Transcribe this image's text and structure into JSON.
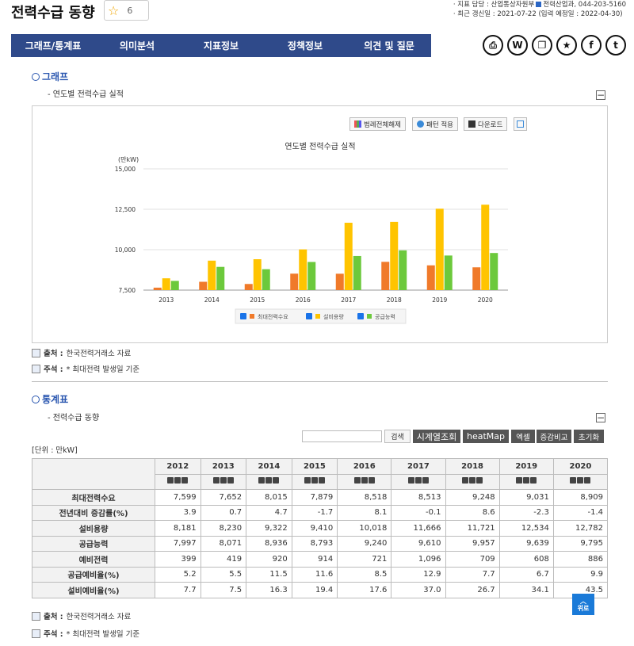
{
  "page": {
    "title": "전력수급 동향",
    "favorite_count": "6",
    "meta_line1_prefix": "· 지표 담당 : 산업통상자원부",
    "meta_line1_suffix": "전력산업과, 044-203-5160",
    "meta_line2": "· 최근 갱신일 : 2021-07-22 (입력 예정일 : 2022-04-30)"
  },
  "nav": [
    "그래프/통계표",
    "의미분석",
    "지표정보",
    "정책정보",
    "의견 및 질문"
  ],
  "share_icons": [
    {
      "name": "print-icon",
      "glyph": "⎙"
    },
    {
      "name": "word-icon",
      "glyph": "W"
    },
    {
      "name": "copy-icon",
      "glyph": "❐"
    },
    {
      "name": "bookmark-star-icon",
      "glyph": "★"
    },
    {
      "name": "facebook-icon",
      "glyph": "f"
    },
    {
      "name": "twitter-icon",
      "glyph": "t"
    }
  ],
  "graph": {
    "section_title": "그래프",
    "subtitle": "- 연도별 전력수급 실적",
    "buttons": {
      "legend_off": "범례전체해제",
      "pattern": "패턴 적용",
      "download": "다운로드"
    },
    "source_label": "출처 :",
    "source_value": "한국전력거래소 자료",
    "note_label": "주석 :",
    "note_value": "* 최대전력 발생일 기준"
  },
  "chart_data": {
    "type": "bar",
    "title": "연도별 전력수급 실적",
    "ylabel": "(만kW)",
    "ylim": [
      7500,
      15000
    ],
    "yticks": [
      "7,500",
      "10,000",
      "12,500",
      "15,000"
    ],
    "categories": [
      "2013",
      "2014",
      "2015",
      "2016",
      "2017",
      "2018",
      "2019",
      "2020"
    ],
    "series": [
      {
        "name": "최대전력수요",
        "color": "#f07a2a",
        "values": [
          7652,
          8015,
          7879,
          8518,
          8513,
          9248,
          9031,
          8909
        ]
      },
      {
        "name": "설비용량",
        "color": "#ffc400",
        "values": [
          8230,
          9322,
          9410,
          10018,
          11666,
          11721,
          12534,
          12782
        ]
      },
      {
        "name": "공급능력",
        "color": "#6cc93c",
        "values": [
          8071,
          8936,
          8793,
          9240,
          9610,
          9957,
          9639,
          9795
        ]
      }
    ],
    "legend_placement": "bottom"
  },
  "stats": {
    "section_title": "통계표",
    "subtitle": "- 전력수급 동향",
    "search_btn": "검색",
    "btn_timeseries": "시계열조회",
    "btn_heatmap": "heatMap",
    "btn_excel": "엑셀",
    "btn_compare": "증감비교",
    "btn_reset": "초기화",
    "unit": "[단위 : 만kW]",
    "years": [
      "2012",
      "2013",
      "2014",
      "2015",
      "2016",
      "2017",
      "2018",
      "2019",
      "2020"
    ],
    "rows": [
      {
        "label": "최대전력수요",
        "values": [
          "7,599",
          "7,652",
          "8,015",
          "7,879",
          "8,518",
          "8,513",
          "9,248",
          "9,031",
          "8,909"
        ]
      },
      {
        "label": "전년대비 증감률(%)",
        "values": [
          "3.9",
          "0.7",
          "4.7",
          "-1.7",
          "8.1",
          "-0.1",
          "8.6",
          "-2.3",
          "-1.4"
        ]
      },
      {
        "label": "설비용량",
        "values": [
          "8,181",
          "8,230",
          "9,322",
          "9,410",
          "10,018",
          "11,666",
          "11,721",
          "12,534",
          "12,782"
        ]
      },
      {
        "label": "공급능력",
        "values": [
          "7,997",
          "8,071",
          "8,936",
          "8,793",
          "9,240",
          "9,610",
          "9,957",
          "9,639",
          "9,795"
        ]
      },
      {
        "label": "예비전력",
        "values": [
          "399",
          "419",
          "920",
          "914",
          "721",
          "1,096",
          "709",
          "608",
          "886"
        ]
      },
      {
        "label": "공급예비율(%)",
        "values": [
          "5.2",
          "5.5",
          "11.5",
          "11.6",
          "8.5",
          "12.9",
          "7.7",
          "6.7",
          "9.9"
        ]
      },
      {
        "label": "설비예비율(%)",
        "values": [
          "7.7",
          "7.5",
          "16.3",
          "19.4",
          "17.6",
          "37.0",
          "26.7",
          "34.1",
          "43.5"
        ]
      }
    ],
    "source_label": "출처 :",
    "source_value": "한국전력거래소 자료",
    "note_label": "주석 :",
    "note_value": "* 최대전력 발생일 기준",
    "top_label": "위로"
  }
}
